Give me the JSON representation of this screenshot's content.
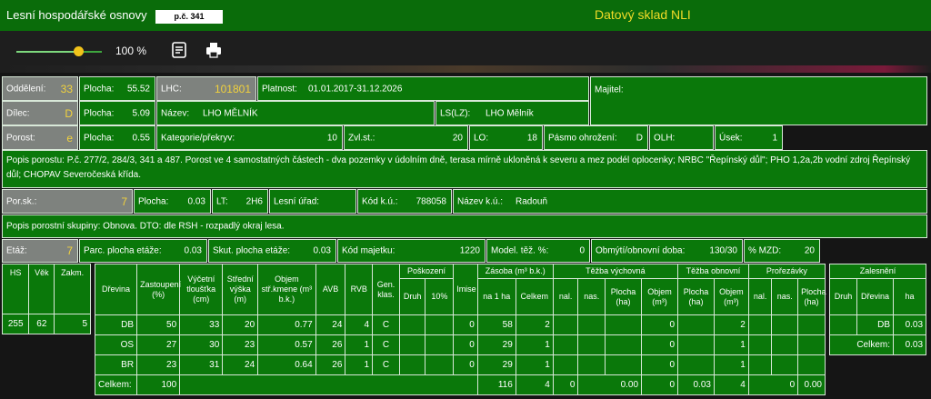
{
  "titlebar": {
    "app_title": "Lesní hospodářské osnovy",
    "plot_badge": "p.č. 341",
    "brand": "Datový sklad NLI"
  },
  "toolbar": {
    "zoom_label": "100 %",
    "zoom_value": 1.0,
    "icons": [
      "slider",
      "notes-icon",
      "printer-icon"
    ]
  },
  "colors": {
    "bar": "#0a6c0a",
    "cell": "#0a780a",
    "accent": "#f2d23c",
    "gray": "#7e827e"
  },
  "row1": {
    "oddeleni_label": "Oddělení:",
    "oddeleni_value": "33",
    "plocha_label": "Plocha:",
    "plocha_value": "55.52",
    "lhc_label": "LHC:",
    "lhc_value": "101801",
    "platnost_label": "Platnost:",
    "platnost_value": "01.01.2017-31.12.2026",
    "majitel_label": "Majitel:"
  },
  "row2": {
    "dilec_label": "Dílec:",
    "dilec_value": "D",
    "plocha_label": "Plocha:",
    "plocha_value": "5.09",
    "nazev_label": "Název:",
    "nazev_value": "LHO MĚLNÍK",
    "ls_label": "LS(LZ):",
    "ls_value": "LHO Mělník"
  },
  "row3": {
    "porost_label": "Porost:",
    "porost_value": "e",
    "plocha_label": "Plocha:",
    "plocha_value": "0.55",
    "kat_label": "Kategorie/překryv:",
    "kat_value": "10",
    "zvl_label": "Zvl.st.:",
    "zvl_value": "20",
    "lo_label": "LO:",
    "lo_value": "18",
    "pasmo_label": "Pásmo ohrožení:",
    "pasmo_value": "D",
    "olh_label": "OLH:",
    "usek_label": "Úsek:",
    "usek_value": "1"
  },
  "popis_porostu": "Popis porostu: P.č. 277/2, 284/3, 341 a 487. Porost ve 4 samostatných částech - dva pozemky v údolním dně, terasa mírně ukloněná k severu a mez podél oplocenky; NRBC \"Řepínský důl\"; PHO 1,2a,2b vodní zdroj Řepínský důl; CHOPAV Severočeská křída.",
  "row5": {
    "porsk_label": "Por.sk.:",
    "porsk_value": "7",
    "plocha_label": "Plocha:",
    "plocha_value": "0.03",
    "lt_label": "LT:",
    "lt_value": "2H6",
    "urad_label": "Lesní úřad:",
    "kod_label": "Kód k.ú.:",
    "kod_value": "788058",
    "nazevku_label": "Název k.ú.:",
    "nazevku_value": "Radouň"
  },
  "popis_skupiny": "Popis porostní skupiny: Obnova. DTO: dle RSH - rozpadlý okraj lesa.",
  "row7": {
    "etaz_label": "Etáž:",
    "etaz_value": "7",
    "parc_label": "Parc. plocha etáže:",
    "parc_value": "0.03",
    "skut_label": "Skut. plocha etáže:",
    "skut_value": "0.03",
    "kodmaj_label": "Kód majetku:",
    "kodmaj_value": "1220",
    "model_label": "Model. těž. %:",
    "model_value": "0",
    "obmyti_label": "Obmýtí/obnovní doba:",
    "obmyti_value": "130/30",
    "mzd_label": "% MZD:",
    "mzd_value": "20"
  },
  "hs_table": {
    "headers": [
      "HS",
      "Věk",
      "Zakm."
    ],
    "values": [
      "255",
      "62",
      "5"
    ]
  },
  "main_table": {
    "groups": {
      "poskozeni": "Poškození",
      "zasoba": "Zásoba (m³ b.k.)",
      "tezba_vych": "Těžba výchovná",
      "tezba_obn": "Těžba obnovní",
      "prorezavky": "Prořezávky"
    },
    "headers": {
      "drevina": "Dřevina",
      "zastoupeni": "Zastoupení (%)",
      "tloustka": "Výčetní tloušťka (cm)",
      "vyska": "Střední výška (m)",
      "objem": "Objem stř.kmene (m³ b.k.)",
      "avb": "AVB",
      "rvb": "RVB",
      "gen": "Gen. klas.",
      "imise": "Imise",
      "druh": "Druh",
      "pct10": "10%",
      "na1ha": "na 1 ha",
      "celkem": "Celkem",
      "nal": "nal.",
      "nas": "nas.",
      "plocha_ha": "Plocha (ha)",
      "objem_m3": "Objem (m³)",
      "plocha_ha2": "Plocha (ha)",
      "objem_m3b": "Objem (m³)",
      "nal2": "nal.",
      "nas2": "nas.",
      "plocha_ha3": "Plocha (ha)"
    },
    "rows": [
      {
        "drevina": "DB",
        "zast": "50",
        "tl": "33",
        "vy": "20",
        "obj": "0.77",
        "avb": "24",
        "rvb": "4",
        "gen": "C",
        "imise": "0",
        "na1ha": "58",
        "celkem": "2",
        "tv_obj": "0",
        "to_obj": "2"
      },
      {
        "drevina": "OS",
        "zast": "27",
        "tl": "30",
        "vy": "23",
        "obj": "0.57",
        "avb": "26",
        "rvb": "1",
        "gen": "C",
        "imise": "0",
        "na1ha": "29",
        "celkem": "1",
        "tv_obj": "0",
        "to_obj": "1"
      },
      {
        "drevina": "BR",
        "zast": "23",
        "tl": "31",
        "vy": "24",
        "obj": "0.64",
        "avb": "26",
        "rvb": "1",
        "gen": "C",
        "imise": "0",
        "na1ha": "29",
        "celkem": "1",
        "tv_obj": "0",
        "to_obj": "1"
      }
    ],
    "total": {
      "label": "Celkem:",
      "zast": "100",
      "na1ha": "116",
      "celkem": "4",
      "tv_nal": "0",
      "tv_plocha": "0.00",
      "tv_obj": "0",
      "to_plocha": "0.03",
      "to_obj": "4",
      "pr_nas": "0",
      "pr_plocha": "0.00"
    }
  },
  "zalesneni": {
    "title": "Zalesnění",
    "headers": [
      "Druh",
      "Dřevina",
      "ha"
    ],
    "row_drevina": "DB",
    "row_ha": "0.03",
    "total_label": "Celkem:",
    "total_ha": "0.03"
  }
}
